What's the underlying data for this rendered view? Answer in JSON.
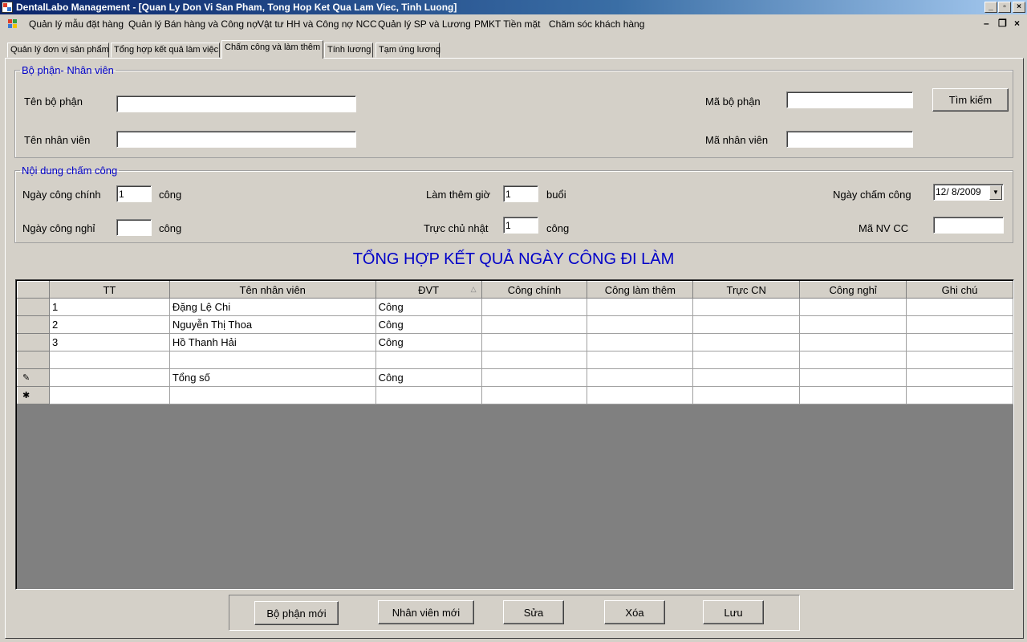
{
  "window": {
    "title": "DentalLabo Management - [Quan Ly Don Vi San Pham, Tong Hop Ket Qua Lam Viec, Tinh Luong]"
  },
  "menu": [
    "Quản lý mẫu đặt hàng",
    "Quản lý Bán hàng và Công nợ",
    "Vật tư HH và Công nợ NCC",
    "Quản lý SP và Lương",
    "PMKT Tiền mặt",
    "Chăm sóc khách hàng"
  ],
  "tabs": [
    "Quản lý đơn vị sản phẩm",
    "Tổng hợp kết quả làm việc",
    "Chấm công và làm thêm",
    "Tính lương",
    "Tạm ứng lương"
  ],
  "dept_group": {
    "legend": "Bộ phận- Nhân viên",
    "dept_name_label": "Tên bộ phận",
    "dept_name_value": "",
    "emp_name_label": "Tên nhân viên",
    "emp_name_value": "",
    "dept_code_label": "Mã bộ phận",
    "dept_code_value": "",
    "emp_code_label": "Mã nhân viên",
    "emp_code_value": "",
    "search_button": "Tìm kiếm"
  },
  "attendance_group": {
    "legend": "Nội dung chấm công",
    "main_days_label": "Ngày công chính",
    "main_days_value": "1",
    "main_days_unit": "công",
    "off_days_label": "Ngày công nghỉ",
    "off_days_value": "",
    "off_days_unit": "công",
    "overtime_label": "Làm thêm giờ",
    "overtime_value": "1",
    "overtime_unit": "buổi",
    "sunday_label": "Trực chủ nhật",
    "sunday_value": "1",
    "sunday_unit": "công",
    "date_label": "Ngày chấm công",
    "date_value": "12/ 8/2009",
    "nvcc_label": "Mã NV CC",
    "nvcc_value": ""
  },
  "summary_title": "TỔNG HỢP KẾT QUẢ NGÀY CÔNG ĐI LÀM",
  "grid": {
    "columns": [
      "TT",
      "Tên nhân viên",
      "ĐVT",
      "Công chính",
      "Công làm thêm",
      "Trực CN",
      "Công nghỉ",
      "Ghi chú"
    ],
    "rows": [
      {
        "marker": "",
        "cells": [
          "1",
          "Đặng Lệ Chi",
          "Công",
          "",
          "",
          "",
          "",
          ""
        ]
      },
      {
        "marker": "",
        "cells": [
          "2",
          "Nguyễn Thị Thoa",
          "Công",
          "",
          "",
          "",
          "",
          ""
        ]
      },
      {
        "marker": "",
        "cells": [
          "3",
          "Hồ Thanh Hải",
          "Công",
          "",
          "",
          "",
          "",
          ""
        ]
      },
      {
        "marker": "",
        "cells": [
          "",
          "",
          "",
          "",
          "",
          "",
          "",
          ""
        ]
      },
      {
        "marker": "✎",
        "cells": [
          "",
          "Tổng số",
          "Công",
          "",
          "",
          "",
          "",
          ""
        ]
      },
      {
        "marker": "✱",
        "cells": [
          "",
          "",
          "",
          "",
          "",
          "",
          "",
          ""
        ]
      }
    ]
  },
  "buttons": {
    "new_dept": "Bộ phận mới",
    "new_emp": "Nhân viên mới",
    "edit": "Sửa",
    "delete": "Xóa",
    "save": "Lưu"
  }
}
